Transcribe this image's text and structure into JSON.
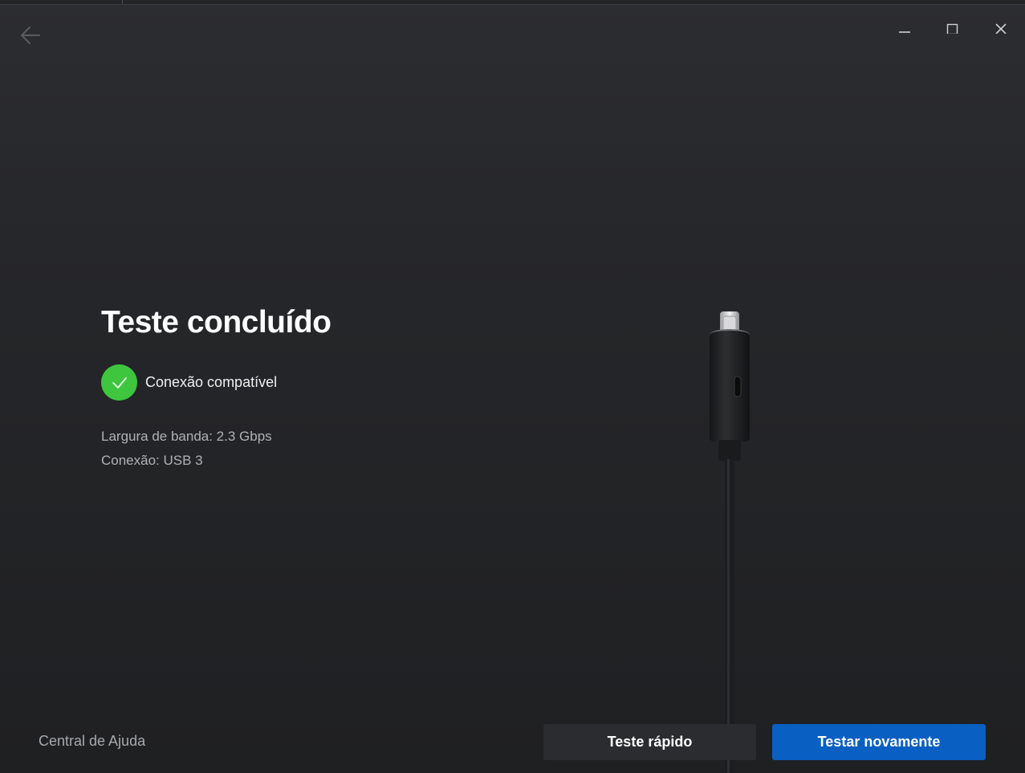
{
  "main": {
    "title": "Teste concluído",
    "status": "Conexão compatível",
    "bandwidth": "Largura de banda: 2.3 Gbps",
    "connection": "Conexão: USB 3"
  },
  "footer": {
    "help_link": "Central de Ajuda",
    "quick_test_label": "Teste rápido",
    "retest_label": "Testar novamente"
  },
  "colors": {
    "success": "#3ec63e",
    "accent": "#0a5fc2"
  },
  "icons": {
    "back": "arrow-left-icon",
    "minimize": "minimize-icon",
    "maximize": "maximize-icon",
    "close": "close-icon",
    "status": "check-icon"
  }
}
